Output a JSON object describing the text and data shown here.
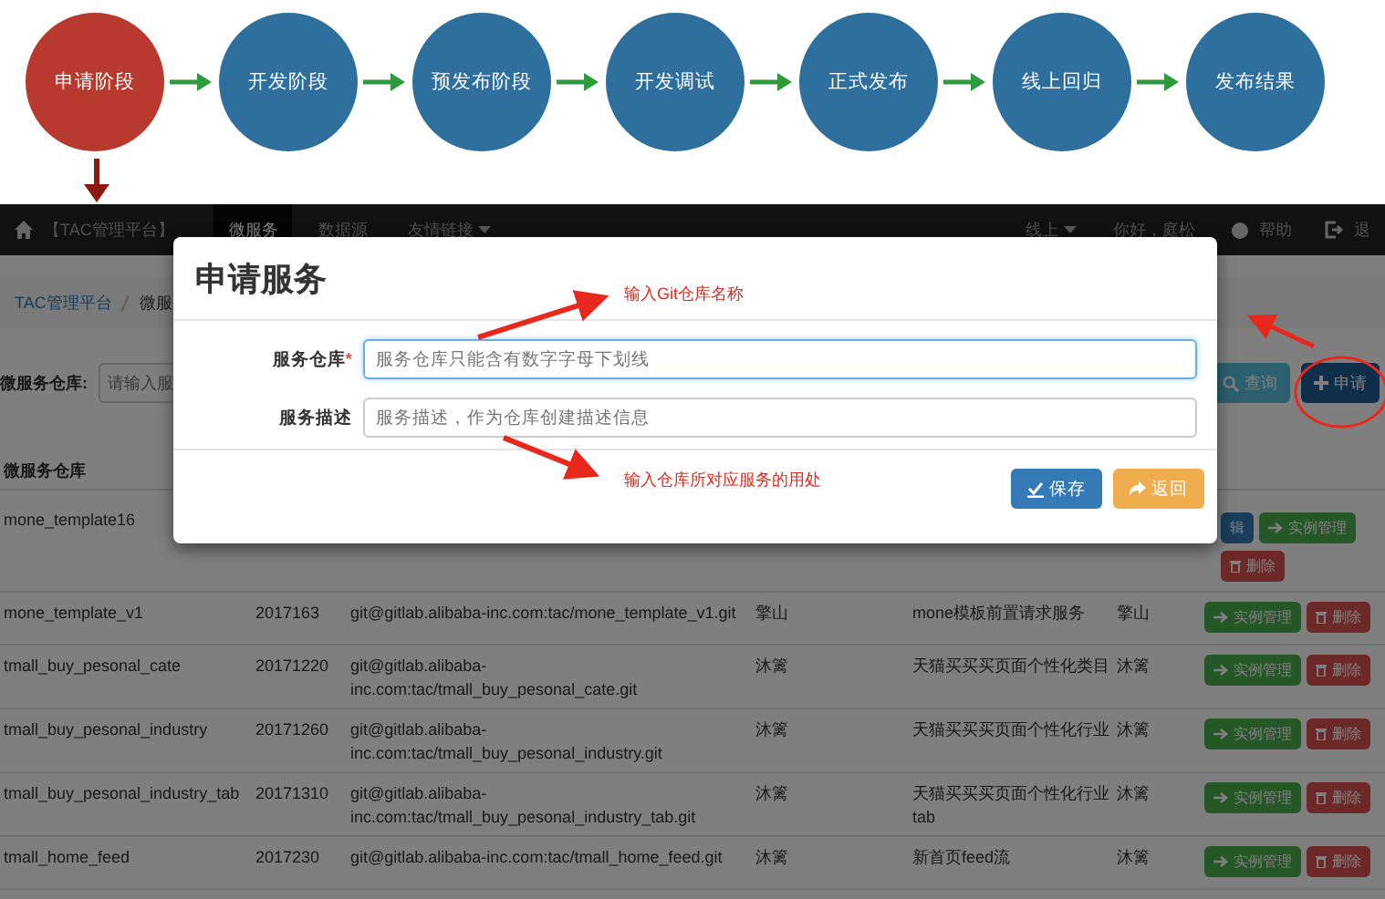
{
  "flow": {
    "steps": [
      {
        "label": "申请阶段",
        "selected": true
      },
      {
        "label": "开发阶段",
        "selected": false
      },
      {
        "label": "预发布阶段",
        "selected": false
      },
      {
        "label": "开发调试",
        "selected": false
      },
      {
        "label": "正式发布",
        "selected": false
      },
      {
        "label": "线上回归",
        "selected": false
      },
      {
        "label": "发布结果",
        "selected": false
      }
    ]
  },
  "navbar": {
    "brand": "【TAC管理平台】",
    "items": [
      {
        "label": "微服务",
        "selected": true,
        "dropdown": false
      },
      {
        "label": "数据源",
        "selected": false,
        "dropdown": false
      },
      {
        "label": "友情链接",
        "selected": false,
        "dropdown": true
      }
    ],
    "right": [
      {
        "label": "线上",
        "kind": "dropdown"
      },
      {
        "label": "你好，庭松",
        "kind": "text"
      },
      {
        "label": "帮助",
        "kind": "help"
      },
      {
        "label": "退",
        "kind": "logout"
      }
    ]
  },
  "breadcrumb": [
    "TAC管理平台",
    "微服"
  ],
  "search": {
    "label": "微服务仓库:",
    "placeholder": "请输入服",
    "buttons": [
      {
        "label": "查询",
        "kind": "search"
      },
      {
        "label": "申请",
        "kind": "add"
      }
    ]
  },
  "table": {
    "columns": [
      "微服务仓库"
    ],
    "rows": [
      {
        "cells": [
          "mone_template16"
        ],
        "actions": [
          {
            "label": "辑",
            "kind": "edit"
          },
          {
            "label": "实例管理",
            "kind": "manage"
          },
          {
            "label": "删除",
            "kind": "delete"
          }
        ]
      },
      {
        "cells": [
          "mone_template_v1",
          "2017163",
          "git@gitlab.alibaba-inc.com:tac/mone_template_v1.git",
          "擎山",
          "mone模板前置请求服务",
          "擎山"
        ],
        "actions": [
          {
            "label": "实例管理",
            "kind": "manage"
          },
          {
            "label": "删除",
            "kind": "delete"
          }
        ]
      },
      {
        "cells": [
          "tmall_buy_pesonal_cate",
          "20171220",
          "git@gitlab.alibaba-inc.com:tac/tmall_buy_pesonal_cate.git",
          "沐篱",
          "天猫买买买页面个性化类目",
          "沐篱"
        ],
        "actions": [
          {
            "label": "实例管理",
            "kind": "manage"
          },
          {
            "label": "删除",
            "kind": "delete"
          }
        ]
      },
      {
        "cells": [
          "tmall_buy_pesonal_industry",
          "20171260",
          "git@gitlab.alibaba-inc.com:tac/tmall_buy_pesonal_industry.git",
          "沐篱",
          "天猫买买买页面个性化行业",
          "沐篱"
        ],
        "actions": [
          {
            "label": "实例管理",
            "kind": "manage"
          },
          {
            "label": "删除",
            "kind": "delete"
          }
        ]
      },
      {
        "cells": [
          "tmall_buy_pesonal_industry_tab",
          "20171310",
          "git@gitlab.alibaba-inc.com:tac/tmall_buy_pesonal_industry_tab.git",
          "沐篱",
          "天猫买买买页面个性化行业tab",
          "沐篱"
        ],
        "actions": [
          {
            "label": "实例管理",
            "kind": "manage"
          },
          {
            "label": "删除",
            "kind": "delete"
          }
        ]
      },
      {
        "cells": [
          "tmall_home_feed",
          "2017230",
          "git@gitlab.alibaba-inc.com:tac/tmall_home_feed.git",
          "沐篱",
          "新首页feed流",
          "沐篱"
        ],
        "actions": [
          {
            "label": "实例管理",
            "kind": "manage"
          },
          {
            "label": "删除",
            "kind": "delete"
          }
        ]
      }
    ]
  },
  "modal": {
    "title": "申请服务",
    "required_mark": "*",
    "fields": [
      {
        "label": "服务仓库",
        "required": true,
        "focused": true,
        "placeholder": "服务仓库只能含有数字字母下划线"
      },
      {
        "label": "服务描述",
        "required": false,
        "focused": false,
        "placeholder": "服务描述，作为仓库创建描述信息"
      }
    ],
    "buttons": [
      {
        "label": "保存",
        "kind": "save"
      },
      {
        "label": "返回",
        "kind": "back"
      }
    ]
  },
  "annotations": [
    "输入Git仓库名称",
    "输入仓库所对应服务的用处"
  ]
}
